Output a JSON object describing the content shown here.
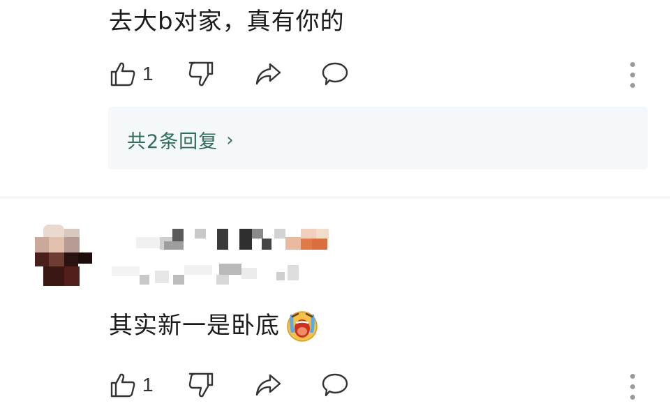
{
  "comments": [
    {
      "text": "去大b对家，真有你的",
      "likes": "1",
      "replies_label": "共2条回复"
    },
    {
      "text": "其实新一是卧底",
      "emoji": "crying-face",
      "likes": "1"
    }
  ],
  "icons": [
    "thumbs-up-icon",
    "thumbs-down-icon",
    "share-icon",
    "comment-icon",
    "more-icon",
    "chevron-right-icon"
  ],
  "colors": {
    "reply_link": "#2f6e5a",
    "reply_box_bg": "#f5f8fa"
  }
}
